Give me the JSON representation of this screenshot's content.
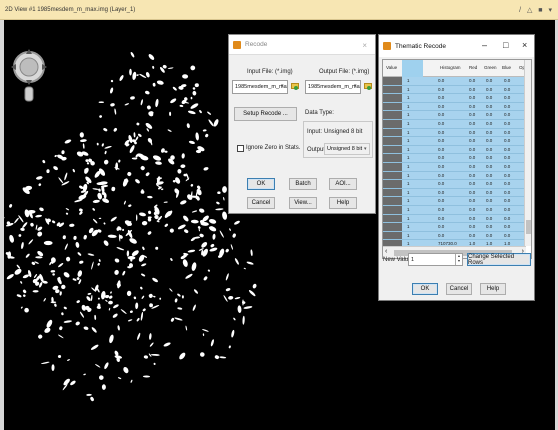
{
  "viewer": {
    "title": "2D View #1 1985mesdem_m_max.img (Layer_1)",
    "titlebar_icons": "/ △ ■ ▾"
  },
  "recode": {
    "title": "Recode",
    "close": "×",
    "input_label": "Input File: (*.img)",
    "input_value": "1985mesdem_m_max.im",
    "output_label": "Output File: (*.img)",
    "output_value": "1985mesdem_m_max_n",
    "setup_button": "Setup Recode ...",
    "data_type_label": "Data Type:",
    "input_type_label": "Input:",
    "input_type_value": "Unsigned 8 bit",
    "output_type_label": "Output:",
    "output_type_value": "Unsigned 8 bit",
    "ignore_zero_label": "Ignore Zero in Stats.",
    "buttons": {
      "ok": "OK",
      "batch": "Batch",
      "aoi": "AOI...",
      "cancel": "Cancel",
      "view": "View...",
      "help": "Help"
    }
  },
  "thematic": {
    "title": "Thematic Recode",
    "minimize": "–",
    "maximize": "□",
    "close": "×",
    "columns": [
      "Value",
      "",
      "Histogram",
      "Red",
      "Green",
      "Blue",
      "Op"
    ],
    "rows": [
      {
        "newval": "1",
        "hist": "0.0",
        "red": "0.0",
        "green": "0.0",
        "blue": "0.0"
      },
      {
        "newval": "1",
        "hist": "0.0",
        "red": "0.0",
        "green": "0.0",
        "blue": "0.0"
      },
      {
        "newval": "1",
        "hist": "0.0",
        "red": "0.0",
        "green": "0.0",
        "blue": "0.0"
      },
      {
        "newval": "1",
        "hist": "0.0",
        "red": "0.0",
        "green": "0.0",
        "blue": "0.0"
      },
      {
        "newval": "1",
        "hist": "0.0",
        "red": "0.0",
        "green": "0.0",
        "blue": "0.0"
      },
      {
        "newval": "1",
        "hist": "0.0",
        "red": "0.0",
        "green": "0.0",
        "blue": "0.0"
      },
      {
        "newval": "1",
        "hist": "0.0",
        "red": "0.0",
        "green": "0.0",
        "blue": "0.0"
      },
      {
        "newval": "1",
        "hist": "0.0",
        "red": "0.0",
        "green": "0.0",
        "blue": "0.0"
      },
      {
        "newval": "1",
        "hist": "0.0",
        "red": "0.0",
        "green": "0.0",
        "blue": "0.0"
      },
      {
        "newval": "1",
        "hist": "0.0",
        "red": "0.0",
        "green": "0.0",
        "blue": "0.0"
      },
      {
        "newval": "1",
        "hist": "0.0",
        "red": "0.0",
        "green": "0.0",
        "blue": "0.0"
      },
      {
        "newval": "1",
        "hist": "0.0",
        "red": "0.0",
        "green": "0.0",
        "blue": "0.0"
      },
      {
        "newval": "1",
        "hist": "0.0",
        "red": "0.0",
        "green": "0.0",
        "blue": "0.0"
      },
      {
        "newval": "1",
        "hist": "0.0",
        "red": "0.0",
        "green": "0.0",
        "blue": "0.0"
      },
      {
        "newval": "1",
        "hist": "0.0",
        "red": "0.0",
        "green": "0.0",
        "blue": "0.0"
      },
      {
        "newval": "1",
        "hist": "0.0",
        "red": "0.0",
        "green": "0.0",
        "blue": "0.0"
      },
      {
        "newval": "1",
        "hist": "0.0",
        "red": "0.0",
        "green": "0.0",
        "blue": "0.0"
      },
      {
        "newval": "1",
        "hist": "0.0",
        "red": "0.0",
        "green": "0.0",
        "blue": "0.0"
      },
      {
        "newval": "1",
        "hist": "0.0",
        "red": "0.0",
        "green": "0.0",
        "blue": "0.0"
      },
      {
        "newval": "1",
        "hist": "710730.0",
        "red": "1.0",
        "green": "1.0",
        "blue": "1.0"
      }
    ],
    "new_value_label": "New Value:",
    "new_value": "1",
    "change_button": "Change Selected Rows",
    "ok": "OK",
    "cancel": "Cancel",
    "help": "Help"
  },
  "colors": {
    "titlebar": "#f7e6b3",
    "selection": "#a8d3ee",
    "canvas": "#000000"
  }
}
